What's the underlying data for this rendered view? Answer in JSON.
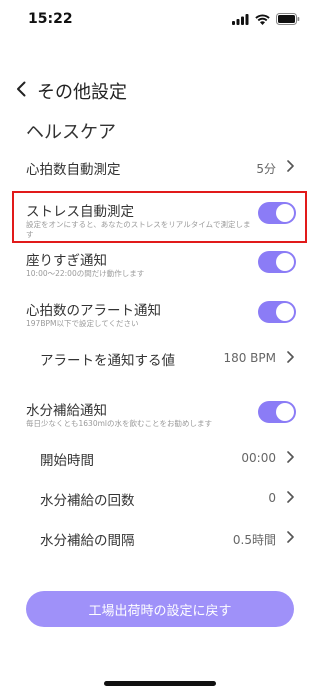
{
  "status_bar": {
    "time": "15:22",
    "icons": [
      "signal-icon",
      "wifi-icon",
      "battery-icon"
    ]
  },
  "nav": {
    "title": "その他設定",
    "back_icon": "chevron-left-icon"
  },
  "section": {
    "title": "ヘルスケア"
  },
  "rows": {
    "auto_heart_rate": {
      "label": "心拍数自動測定",
      "value": "5分"
    },
    "auto_stress": {
      "label": "ストレス自動測定",
      "sub": "設定をオンにすると、あなたのストレスをリアルタイムで測定します",
      "enabled": true
    },
    "sedentary": {
      "label": "座りすぎ通知",
      "sub": "10:00～22:00の間だけ動作します",
      "enabled": true
    },
    "heart_alert": {
      "label": "心拍数のアラート通知",
      "sub": "197BPM以下で設定してください",
      "enabled": true
    },
    "alert_value": {
      "label": "アラートを通知する値",
      "value": "180 BPM"
    },
    "hydration": {
      "label": "水分補給通知",
      "sub": "毎日少なくとも1630mlの水を飲むことをお勧めします",
      "enabled": true
    },
    "start_time": {
      "label": "開始時間",
      "value": "00:00"
    },
    "hydration_count": {
      "label": "水分補給の回数",
      "value": "0"
    },
    "hydration_interval": {
      "label": "水分補給の間隔",
      "value": "0.5時間"
    }
  },
  "reset_button": {
    "label": "工場出荷時の設定に戻す"
  },
  "colors": {
    "accent": "#8b7cf6",
    "button": "#9f91f9",
    "highlight": "#e11a1a"
  }
}
